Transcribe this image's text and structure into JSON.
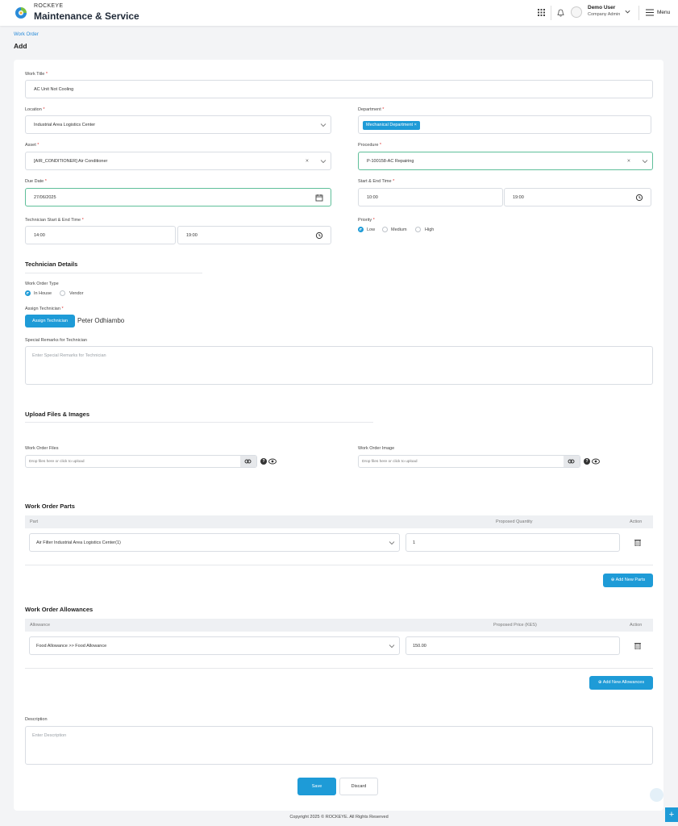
{
  "brand": {
    "company": "ROCKEYE",
    "app": "Maintenance & Service"
  },
  "header": {
    "user_name": "Demo User",
    "user_role": "Company Admin",
    "menu_label": "Menu"
  },
  "breadcrumb": "Work Order",
  "page_title": "Add",
  "form": {
    "work_title": {
      "label": "Work Title",
      "value": "AC Unit Not Cooling"
    },
    "location": {
      "label": "Location",
      "value": "Industrial Area Logistics Center"
    },
    "department": {
      "label": "Department",
      "tag": "Mechanical Department ×"
    },
    "asset": {
      "label": "Asset",
      "value": "[AIR_CONDITIONER] Air Conditioner"
    },
    "procedure": {
      "label": "Procedure",
      "value": "P-100158-AC Repairing"
    },
    "due_date": {
      "label": "Due Date",
      "value": "27/06/2025"
    },
    "start_end_time": {
      "label": "Start & End Time",
      "start": "10:00",
      "end": "19:00"
    },
    "technician_time": {
      "label": "Technician Start & End Time",
      "start": "14:00",
      "end": "19:00"
    },
    "priority": {
      "label": "Priority",
      "options": [
        "Low",
        "Medium",
        "High"
      ],
      "selected": "Low"
    }
  },
  "technician": {
    "section_title": "Technician Details",
    "type_label": "Work Order Type",
    "type_options": [
      "In House",
      "Vendor"
    ],
    "type_selected": "In House",
    "assign_label": "Assign Technician",
    "assign_button": "Assign Technician",
    "assigned_name": "Peter Odhiambo",
    "remarks_label": "Special Remarks for Technician",
    "remarks_placeholder": "Enter Special Remarks for Technician"
  },
  "uploads": {
    "section_title": "Upload Files & Images",
    "files_label": "Work Order Files",
    "files_placeholder": "Drop files here or click to upload",
    "image_label": "Work Order Image",
    "image_placeholder": "Drop files here or click to upload"
  },
  "parts": {
    "section_title": "Work Order Parts",
    "columns": [
      "Part",
      "Proposed Quantity",
      "Action"
    ],
    "rows": [
      {
        "part": "Air Filter   Industrial Area Logistics Center(1)",
        "quantity": "1"
      }
    ],
    "add_button": "⊕ Add New Parts"
  },
  "allowances": {
    "section_title": "Work Order Allowances",
    "columns": [
      "Allowance",
      "Proposed Price (KES)",
      "Action"
    ],
    "rows": [
      {
        "allowance": "Food Allowance >> Food Allowance",
        "price": "150.00"
      }
    ],
    "add_button": "⊕ Add New Allowances"
  },
  "description": {
    "label": "Description",
    "placeholder": "Enter Description"
  },
  "actions": {
    "save": "Save",
    "discard": "Discard"
  },
  "footer": "Copyright 2025 © ROCKEYE. All Rights Reserved",
  "colors": {
    "accent": "#1e9bd7",
    "focus_border": "#5fbf9a",
    "background": "#f3f4f6"
  },
  "icons": [
    "grid-icon",
    "bell-icon",
    "user-avatar-icon",
    "chevron-down-icon",
    "hamburger-icon",
    "calendar-icon",
    "clock-icon",
    "clear-icon",
    "link-icon",
    "help-icon",
    "eye-icon",
    "trash-icon",
    "plus-icon"
  ]
}
